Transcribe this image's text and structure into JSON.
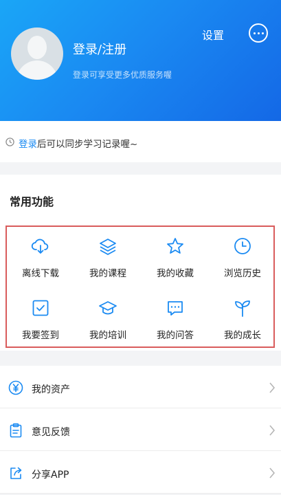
{
  "header": {
    "login_title": "登录/注册",
    "login_subtitle": "登录可享受更多优质服务喔",
    "settings_label": "设置"
  },
  "sync_bar": {
    "link_text": "登录",
    "rest_text": "后可以同步学习记录喔~"
  },
  "functions": {
    "title": "常用功能",
    "items": [
      {
        "label": "离线下载",
        "icon": "cloud-download-icon"
      },
      {
        "label": "我的课程",
        "icon": "layers-icon"
      },
      {
        "label": "我的收藏",
        "icon": "star-icon"
      },
      {
        "label": "浏览历史",
        "icon": "clock-icon"
      },
      {
        "label": "我要签到",
        "icon": "checkbox-icon"
      },
      {
        "label": "我的培训",
        "icon": "graduation-cap-icon"
      },
      {
        "label": "我的问答",
        "icon": "chat-bubble-icon"
      },
      {
        "label": "我的成长",
        "icon": "sprout-icon"
      }
    ]
  },
  "menu": {
    "items": [
      {
        "label": "我的资产",
        "icon": "yen-coin-icon"
      },
      {
        "label": "意见反馈",
        "icon": "clipboard-icon"
      },
      {
        "label": "分享APP",
        "icon": "share-icon"
      }
    ]
  },
  "colors": {
    "accent": "#1a8af2",
    "header_gradient_start": "#1aa6f7",
    "header_gradient_end": "#1468e6",
    "highlight_border": "#d95b5b"
  }
}
